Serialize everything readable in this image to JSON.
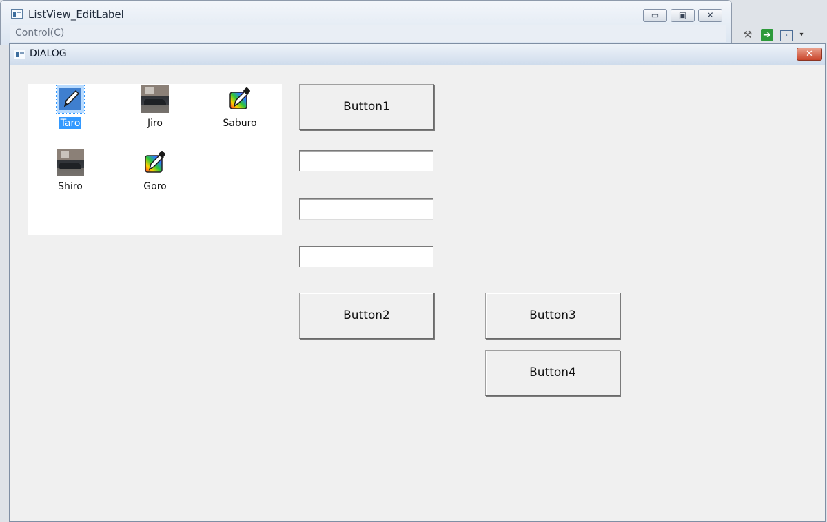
{
  "background_window": {
    "title": "ListView_EditLabel",
    "menu": [
      "Control(C)"
    ],
    "controls": {
      "minimize": "▭",
      "restore": "▣",
      "close": "✕"
    }
  },
  "dialog": {
    "title": "DIALOG",
    "close_glyph": "✕",
    "listview": {
      "items": [
        {
          "label": "Taro",
          "icon": "pencil-icon",
          "selected": true
        },
        {
          "label": "Jiro",
          "icon": "car-photo-icon",
          "selected": false
        },
        {
          "label": "Saburo",
          "icon": "pencil-icon",
          "selected": false
        },
        {
          "label": "Shiro",
          "icon": "car-photo-icon",
          "selected": false
        },
        {
          "label": "Goro",
          "icon": "pencil-icon",
          "selected": false
        }
      ]
    },
    "buttons": {
      "button1": "Button1",
      "button2": "Button2",
      "button3": "Button3",
      "button4": "Button4"
    },
    "edits": [
      "",
      "",
      ""
    ]
  },
  "colors": {
    "selection": "#3399ff",
    "dialog_bg": "#f0f0f0",
    "close_button": "#c9452b"
  }
}
